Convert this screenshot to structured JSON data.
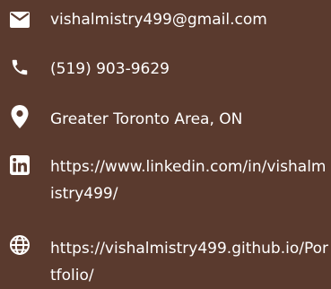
{
  "contacts": {
    "email": {
      "icon": "envelope-icon",
      "text": "vishalmistry499@gmail.com"
    },
    "phone": {
      "icon": "phone-icon",
      "text": "(519) 903-9629"
    },
    "location": {
      "icon": "map-pin-icon",
      "text": "Greater Toronto Area, ON"
    },
    "linkedin": {
      "icon": "linkedin-icon",
      "text": "https://www.linkedin.com/in/vishalmistry499/"
    },
    "website": {
      "icon": "globe-icon",
      "text": "https://vishalmistry499.github.io/Portfolio/"
    }
  },
  "colors": {
    "background": "#5a3a2e",
    "foreground": "#ffffff"
  }
}
